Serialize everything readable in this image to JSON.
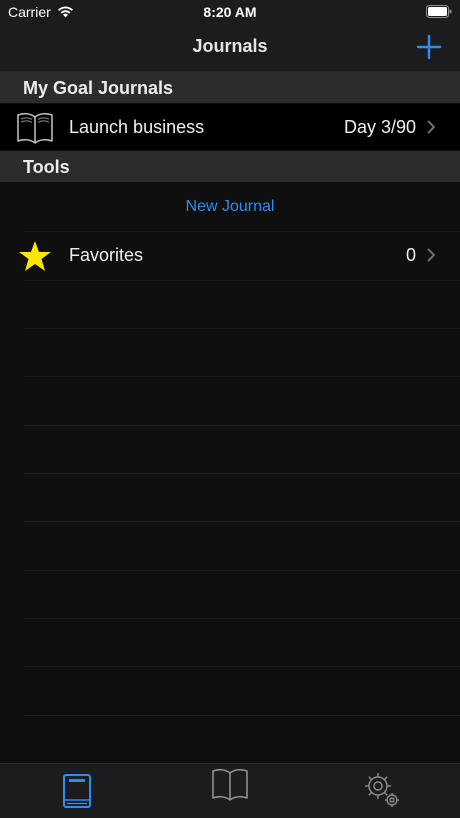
{
  "status_bar": {
    "carrier": "Carrier",
    "time": "8:20 AM"
  },
  "nav": {
    "title": "Journals",
    "add_icon": "plus-icon"
  },
  "sections": {
    "goal_journals": "My Goal Journals",
    "tools": "Tools"
  },
  "journals": [
    {
      "label": "Launch business",
      "detail": "Day 3/90",
      "icon": "open-book-icon"
    }
  ],
  "tools": {
    "new_journal_label": "New Journal",
    "favorites": {
      "label": "Favorites",
      "count": "0",
      "icon": "star-icon"
    }
  },
  "tab_bar": {
    "tabs": [
      {
        "icon": "closed-book-icon",
        "selected": true
      },
      {
        "icon": "open-book-icon",
        "selected": false
      },
      {
        "icon": "gears-icon",
        "selected": false
      }
    ]
  },
  "colors": {
    "accent": "#2f8cf0",
    "star": "#ffe600",
    "background": "#0f0f0f",
    "bar": "#1c1c1e",
    "section_header": "#2c2c2e"
  }
}
